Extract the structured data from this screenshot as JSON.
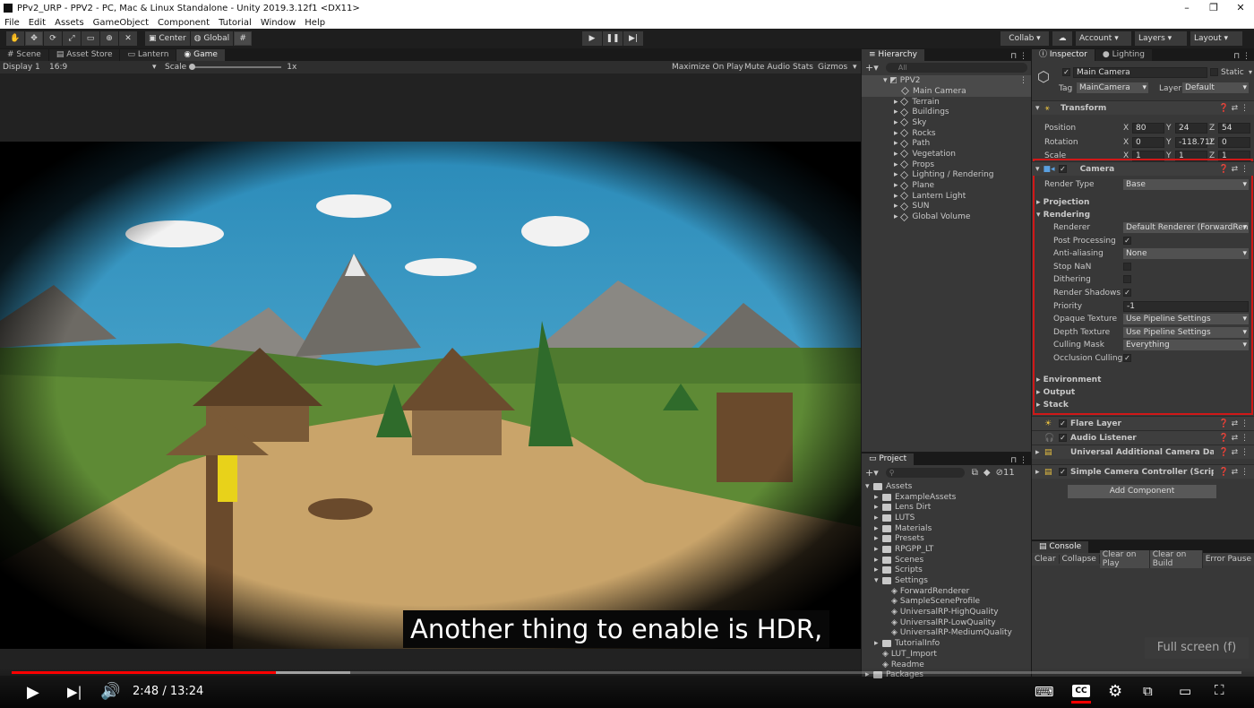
{
  "window": {
    "title": "PPv2_URP - PPV2 - PC, Mac & Linux Standalone - Unity 2019.3.12f1 <DX11>"
  },
  "menu": [
    "File",
    "Edit",
    "Assets",
    "GameObject",
    "Component",
    "Tutorial",
    "Window",
    "Help"
  ],
  "toolbar": {
    "center": "Center",
    "global": "Global",
    "collab": "Collab ▾",
    "account": "Account",
    "layers": "Layers",
    "layout": "Layout"
  },
  "tabs": {
    "scene": "Scene",
    "asset_store": "Asset Store",
    "lantern": "Lantern",
    "game": "Game",
    "hierarchy": "Hierarchy",
    "inspector": "Inspector",
    "lighting": "Lighting",
    "project": "Project",
    "console": "Console"
  },
  "game_bar": {
    "display": "Display 1",
    "aspect": "16:9",
    "scale_label": "Scale",
    "scale_value": "1x",
    "maximize": "Maximize On Play",
    "mute": "Mute Audio",
    "stats": "Stats",
    "gizmos": "Gizmos"
  },
  "hierarchy": {
    "search_placeholder": "All",
    "root": "PPV2",
    "items": [
      "Main Camera",
      "Terrain",
      "Buildings",
      "Sky",
      "Rocks",
      "Path",
      "Vegetation",
      "Props",
      "Lighting / Rendering",
      "Plane",
      "Lantern Light",
      "SUN",
      "Global Volume"
    ]
  },
  "inspector": {
    "object_name": "Main Camera",
    "static": "Static",
    "tag_label": "Tag",
    "tag": "MainCamera",
    "layer_label": "Layer",
    "layer": "Default",
    "transform": {
      "title": "Transform",
      "position": "Position",
      "rotation": "Rotation",
      "scale": "Scale",
      "pos": [
        "80",
        "24",
        "54"
      ],
      "rot": [
        "0",
        "-118.71!",
        "0"
      ],
      "scl": [
        "1",
        "1",
        "1"
      ],
      "axes": [
        "X",
        "Y",
        "Z"
      ]
    },
    "camera": {
      "title": "Camera",
      "render_type_label": "Render Type",
      "render_type": "Base",
      "projection": "Projection",
      "rendering": "Rendering",
      "rows": [
        {
          "label": "Renderer",
          "value": "Default Renderer (ForwardRenc",
          "kind": "dd"
        },
        {
          "label": "Post Processing",
          "value": "✓",
          "kind": "chk"
        },
        {
          "label": "Anti-aliasing",
          "value": "None",
          "kind": "dd"
        },
        {
          "label": "Stop NaN",
          "value": "",
          "kind": "chk"
        },
        {
          "label": "Dithering",
          "value": "",
          "kind": "chk"
        },
        {
          "label": "Render Shadows",
          "value": "✓",
          "kind": "chk"
        },
        {
          "label": "Priority",
          "value": "-1",
          "kind": "field"
        },
        {
          "label": "Opaque Texture",
          "value": "Use Pipeline Settings",
          "kind": "dd"
        },
        {
          "label": "Depth Texture",
          "value": "Use Pipeline Settings",
          "kind": "dd"
        },
        {
          "label": "Culling Mask",
          "value": "Everything",
          "kind": "dd"
        },
        {
          "label": "Occlusion Culling",
          "value": "✓",
          "kind": "chk"
        }
      ],
      "environment": "Environment",
      "output": "Output",
      "stack": "Stack"
    },
    "components": [
      "Flare Layer",
      "Audio Listener",
      "Universal Additional Camera Data (S",
      "Simple Camera Controller (Script)"
    ],
    "add_component": "Add Component"
  },
  "project": {
    "count": "11",
    "assets": "Assets",
    "folders": [
      "ExampleAssets",
      "Lens Dirt",
      "LUTS",
      "Materials",
      "Presets",
      "RPGPP_LT",
      "Scenes",
      "Scripts",
      "Settings"
    ],
    "settings_items": [
      "ForwardRenderer",
      "SampleSceneProfile",
      "UniversalRP-HighQuality",
      "UniversalRP-LowQuality",
      "UniversalRP-MediumQuality"
    ],
    "after": [
      "TutorialInfo",
      "LUT_Import",
      "Readme"
    ],
    "packages": "Packages"
  },
  "console": {
    "buttons": [
      "Clear",
      "Collapse",
      "Clear on Play",
      "Clear on Build",
      "Error Pause"
    ]
  },
  "video": {
    "caption": "Another thing to enable is HDR,",
    "time_current": "2:48",
    "time_total": "13:24",
    "time_sep": " / ",
    "fullscreen_hint": "Full screen (f)",
    "progress": 0.215,
    "buffered": 0.275,
    "cc_label": "CC"
  }
}
